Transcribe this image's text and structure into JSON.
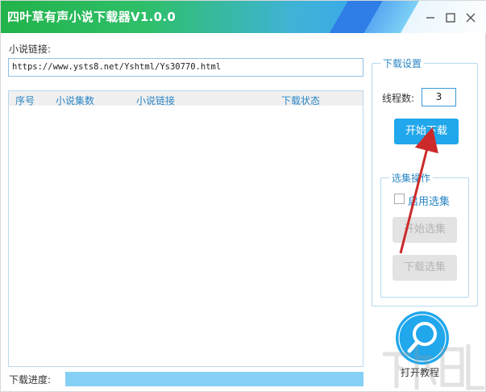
{
  "window": {
    "title": "四叶草有声小说下载器V1.0.0",
    "controls": {
      "minimize": "minimize-icon",
      "maximize": "maximize-icon",
      "close": "close-icon"
    }
  },
  "link_section": {
    "label": "小说链接:",
    "url_value": "https://www.ysts8.net/Yshtml/Ys30770.html"
  },
  "table": {
    "columns": [
      "序号",
      "小说集数",
      "小说链接",
      "下载状态"
    ],
    "rows": []
  },
  "progress": {
    "label": "下载进度:",
    "value_fraction": 1.0
  },
  "settings": {
    "legend": "下载设置",
    "threads_label": "线程数:",
    "threads_value": "3",
    "start_download_label": "开始下载"
  },
  "episode_select": {
    "legend": "选集操作",
    "enable_label": "启用选集",
    "enable_checked": false,
    "start_select_label": "开始选集",
    "download_select_label": "下载选集"
  },
  "help": {
    "icon": "search-icon",
    "label": "打开教程"
  },
  "colors": {
    "accent": "#20a7ec",
    "legend_text": "#2b86c5",
    "progress_fill": "#86d0f5",
    "annotation_arrow": "#cc2a2a"
  }
}
